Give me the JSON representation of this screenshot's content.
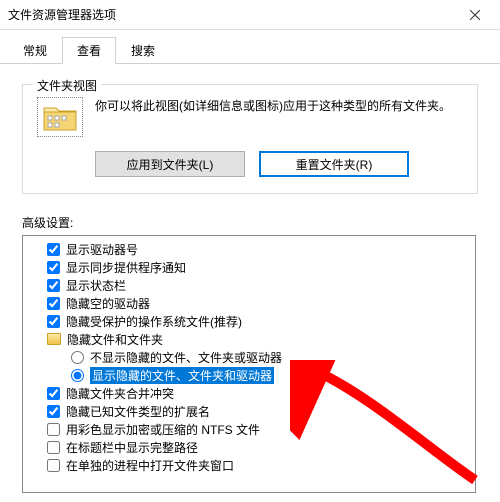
{
  "window": {
    "title": "文件资源管理器选项"
  },
  "tabs": {
    "general": "常规",
    "view": "查看",
    "search": "搜索"
  },
  "group": {
    "title": "文件夹视图",
    "desc": "你可以将此视图(如详细信息或图标)应用于这种类型的所有文件夹。",
    "apply_btn": "应用到文件夹(L)",
    "reset_btn": "重置文件夹(R)"
  },
  "advanced_label": "高级设置:",
  "tree": {
    "i0": "显示驱动器号",
    "i1": "显示同步提供程序通知",
    "i2": "显示状态栏",
    "i3": "隐藏空的驱动器",
    "i4": "隐藏受保护的操作系统文件(推荐)",
    "i5": "隐藏文件和文件夹",
    "i6": "不显示隐藏的文件、文件夹或驱动器",
    "i7": "显示隐藏的文件、文件夹和驱动器",
    "i8": "隐藏文件夹合并冲突",
    "i9": "隐藏已知文件类型的扩展名",
    "i10": "用彩色显示加密或压缩的 NTFS 文件",
    "i11": "在标题栏中显示完整路径",
    "i12": "在单独的进程中打开文件夹窗口"
  }
}
